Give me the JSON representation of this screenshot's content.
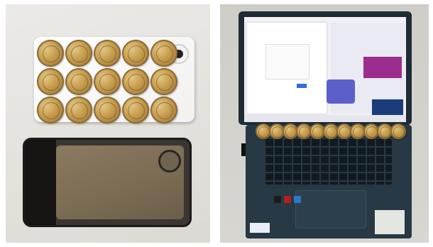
{
  "image": {
    "left_photo_subject": "coins-on-white-phone-and-dark-phone-case",
    "right_photo_subject": "open-laptop-with-coin-row"
  },
  "colors": {
    "background": "#ffffff",
    "coin_gold": "#c49a4a",
    "laptop_body": "#263944",
    "teams_purple": "#5b5fc7"
  }
}
